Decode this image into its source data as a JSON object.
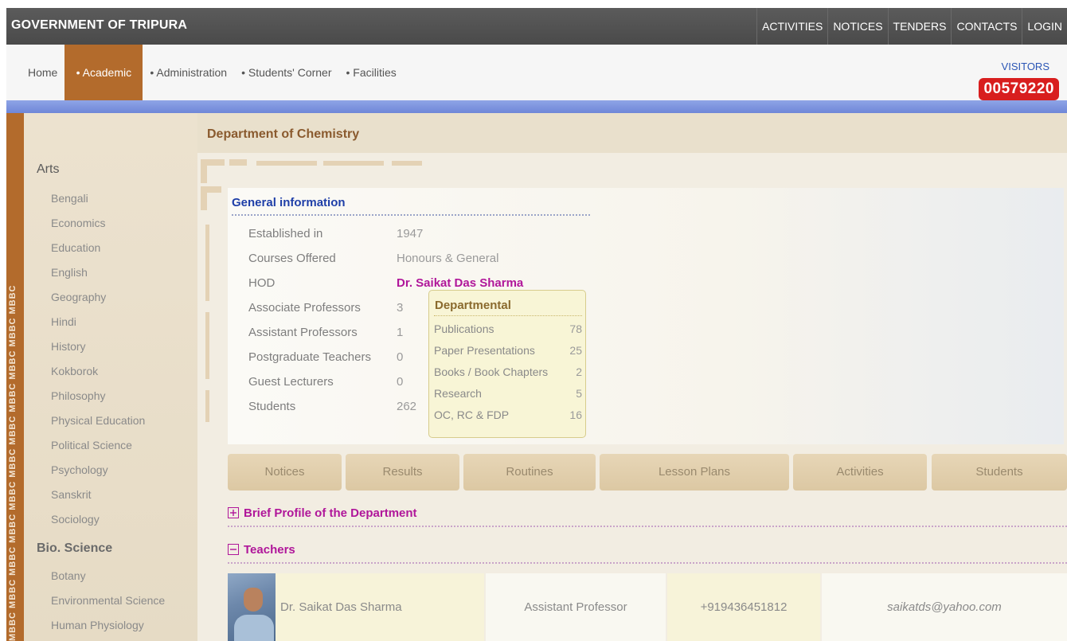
{
  "topbar": {
    "title": "GOVERNMENT OF TRIPURA",
    "links": [
      "ACTIVITIES",
      "NOTICES",
      "TENDERS",
      "CONTACTS",
      "LOGIN"
    ]
  },
  "nav": {
    "items": [
      "Home",
      "• Academic",
      "• Administration",
      "• Students' Corner",
      "• Facilities"
    ],
    "active": "• Academic"
  },
  "visitors": {
    "label": "VISITORS",
    "count": "00579220"
  },
  "side_band": {
    "text": "MBBC MBBC MBBC MBBC MBBC MBBC MBBC MBBC MBBC MBBC MBBC"
  },
  "sidebar": {
    "sections": [
      {
        "title": "Arts",
        "items": [
          "Bengali",
          "Economics",
          "Education",
          "English",
          "Geography",
          "Hindi",
          "History",
          "Kokborok",
          "Philosophy",
          "Physical Education",
          "Political Science",
          "Psychology",
          "Sanskrit",
          "Sociology"
        ]
      },
      {
        "title": "Bio. Science",
        "items": [
          "Botany",
          "Environmental Science",
          "Human Physiology"
        ]
      }
    ]
  },
  "main": {
    "department_title": "Department of Chemistry",
    "general_info": {
      "title": "General information",
      "rows": [
        {
          "label": "Established in",
          "value": "1947"
        },
        {
          "label": "Courses Offered",
          "value": "Honours & General"
        },
        {
          "label": "HOD",
          "value": "Dr. Saikat Das Sharma"
        },
        {
          "label": "Associate Professors",
          "value": "3"
        },
        {
          "label": "Assistant Professors",
          "value": "1"
        },
        {
          "label": "Postgraduate Teachers",
          "value": "0"
        },
        {
          "label": "Guest Lecturers",
          "value": "0"
        },
        {
          "label": "Students",
          "value": "262"
        }
      ]
    },
    "departmental": {
      "title": "Departmental",
      "rows": [
        {
          "label": "Publications",
          "value": "78"
        },
        {
          "label": "Paper Presentations",
          "value": "25"
        },
        {
          "label": "Books / Book Chapters",
          "value": "2"
        },
        {
          "label": "Research",
          "value": "5"
        },
        {
          "label": "OC, RC & FDP",
          "value": "16"
        }
      ]
    },
    "tabs": [
      "Notices",
      "Results",
      "Routines",
      "Lesson Plans",
      "Activities",
      "Students"
    ],
    "sections": {
      "brief_profile": "Brief Profile of the Department",
      "teachers": "Teachers"
    },
    "teachers": [
      {
        "name": "Dr. Saikat Das Sharma",
        "designation": "Assistant Professor",
        "phone": "+919436451812",
        "email": "saikatds@yahoo.com"
      }
    ]
  }
}
